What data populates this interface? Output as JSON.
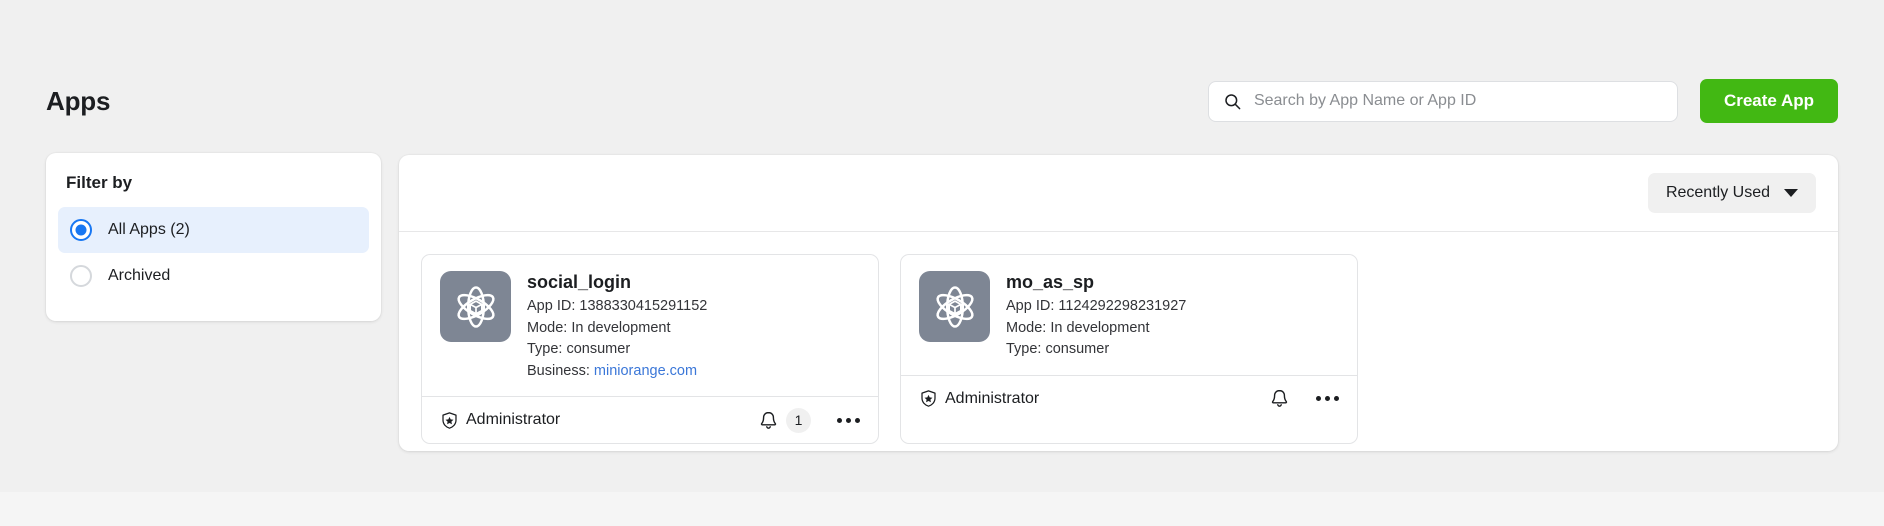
{
  "header": {
    "title": "Apps",
    "search": {
      "placeholder": "Search by App Name or App ID",
      "value": "",
      "icon": "search-icon"
    },
    "create_button": {
      "label": "Create App",
      "color": "#42b813"
    }
  },
  "sidebar": {
    "title": "Filter by",
    "items": [
      {
        "label": "All Apps (2)",
        "selected": true
      },
      {
        "label": "Archived",
        "selected": false
      }
    ],
    "selected_color": "#1877f2",
    "selected_bg": "#e7f0fd"
  },
  "toolbar": {
    "sort": {
      "label": "Recently Used",
      "icon": "chevron-down-icon"
    }
  },
  "apps": [
    {
      "name": "social_login",
      "icon": "atom-icon",
      "app_id_label": "App ID: 1388330415291152",
      "mode_label": "Mode: In development",
      "type_label": "Type: consumer",
      "business_prefix": "Business: ",
      "business_link": "miniorange.com",
      "has_business": true,
      "role": "Administrator",
      "role_icon": "shield-star-icon",
      "notification_icon": "bell-icon",
      "notification_count": "1",
      "has_notification_badge": true,
      "menu_icon": "more-options-icon"
    },
    {
      "name": "mo_as_sp",
      "icon": "atom-icon",
      "app_id_label": "App ID: 1124292298231927",
      "mode_label": "Mode: In development",
      "type_label": "Type: consumer",
      "business_prefix": "",
      "business_link": "",
      "has_business": false,
      "role": "Administrator",
      "role_icon": "shield-star-icon",
      "notification_icon": "bell-icon",
      "notification_count": "",
      "has_notification_badge": false,
      "menu_icon": "more-options-icon"
    }
  ],
  "colors": {
    "page_bg": "#f0f0f0",
    "accent_green": "#42b813",
    "accent_blue": "#1877f2",
    "link_blue": "#3b77d8",
    "app_icon_bg": "#7e8694"
  }
}
